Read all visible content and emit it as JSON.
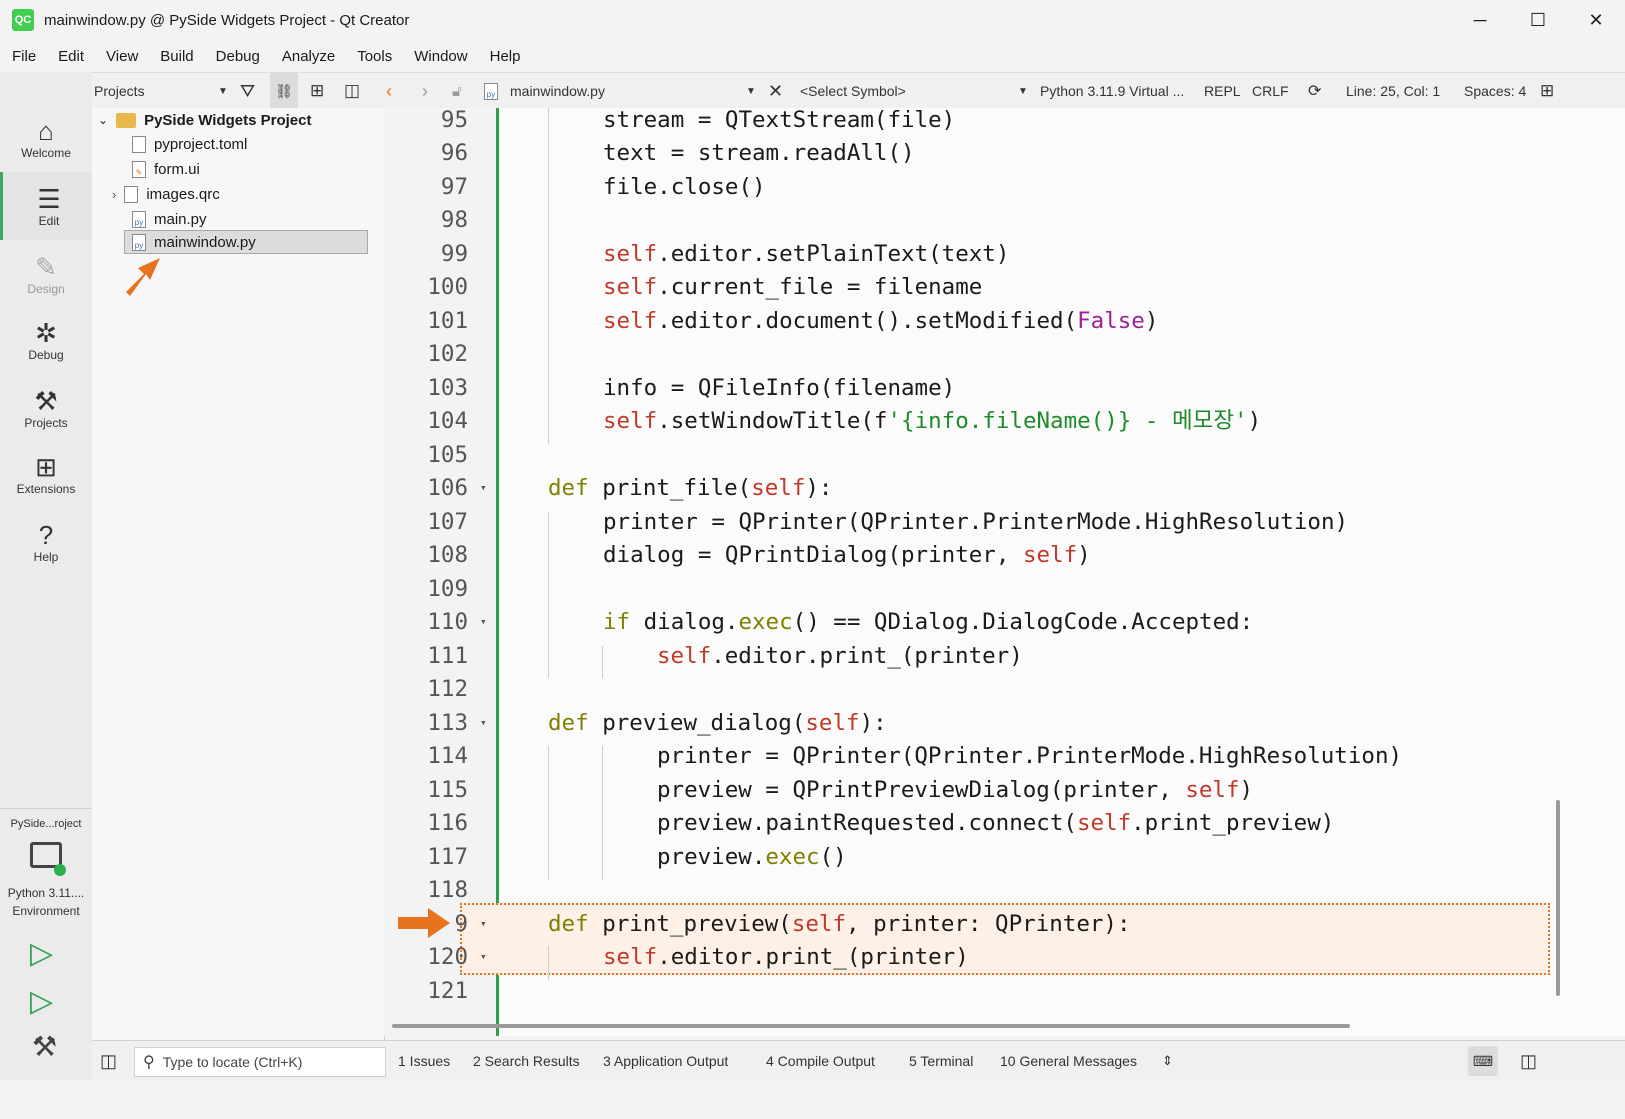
{
  "window": {
    "title": "mainwindow.py @ PySide Widgets Project - Qt Creator",
    "app_icon": "QC",
    "minimize_icon": "─",
    "maximize_icon": "☐",
    "close_icon": "✕"
  },
  "menu": [
    "File",
    "Edit",
    "View",
    "Build",
    "Debug",
    "Analyze",
    "Tools",
    "Window",
    "Help"
  ],
  "toolbar": {
    "projects_combo": "Projects",
    "file_combo": "mainwindow.py",
    "symbol_combo": "<Select Symbol>",
    "python_env": "Python 3.11.9 Virtual ...",
    "repl": "REPL",
    "line_ending": "CRLF",
    "cursor_pos": "Line: 25, Col: 1",
    "spaces": "Spaces: 4"
  },
  "modes": [
    {
      "label": "Welcome",
      "icon": "home-icon"
    },
    {
      "label": "Edit",
      "icon": "edit-icon"
    },
    {
      "label": "Design",
      "icon": "design-icon"
    },
    {
      "label": "Debug",
      "icon": "debug-icon"
    },
    {
      "label": "Projects",
      "icon": "wrench-icon"
    },
    {
      "label": "Extensions",
      "icon": "extensions-icon"
    },
    {
      "label": "Help",
      "icon": "help-icon"
    }
  ],
  "target": {
    "project": "PySide...roject",
    "kit_line1": "Python 3.11....",
    "kit_line2": "Environment"
  },
  "tree": {
    "project": "PySide Widgets Project",
    "files": [
      "pyproject.toml",
      "form.ui",
      "images.qrc",
      "main.py",
      "mainwindow.py"
    ]
  },
  "code": {
    "line_numbers": [
      "95",
      "96",
      "97",
      "98",
      "99",
      "100",
      "101",
      "102",
      "103",
      "104",
      "105",
      "106",
      "107",
      "108",
      "109",
      "110",
      "111",
      "112",
      "113",
      "114",
      "115",
      "116",
      "117",
      "118",
      "9",
      "120",
      "121"
    ],
    "lines": [
      "stream = QTextStream(file)",
      "text = stream.readAll()",
      "file.close()",
      "",
      ".editor.setPlainText(text)",
      ".current_file = filename",
      ".editor.document().setModified(",
      "",
      "info = QFileInfo(filename)",
      ".setWindowTitle(f",
      "",
      "print_file(",
      "printer = QPrinter(QPrinter.PrinterMode.HighResolution)",
      "dialog = QPrintDialog(printer, ",
      "",
      " dialog.",
      ".editor.print_(printer)",
      "",
      "preview_dialog(",
      "printer = QPrinter(QPrinter.PrinterMode.HighResolution)",
      "preview = QPrintPreviewDialog(printer, ",
      "preview.paintRequested.connect(",
      "preview.",
      "",
      "print_preview(",
      ".editor.print_(printer)",
      ""
    ],
    "tokens": {
      "self": "self",
      "def": "def",
      "if": "if",
      "false": "False",
      "exec": "exec",
      "fstring": "'{info.fileName()} - 메모장'",
      "close_paren": ")",
      "self_close": "):",
      "cond_rest": "() == QDialog.DialogCode.Accepted:",
      "print_preview_ref": ".print_preview)",
      "exec_call": "()",
      "print_preview_args": ", printer: QPrinter):"
    }
  },
  "status": {
    "locate_placeholder": "Type to locate (Ctrl+K)",
    "panes": [
      "1  Issues",
      "2  Search Results",
      "3  Application Output",
      "4  Compile Output",
      "5  Terminal",
      "10  General Messages"
    ]
  },
  "colors": {
    "accent_green": "#2e9e4a",
    "annotation_orange": "#e8731f",
    "keyword": "#808000",
    "self": "#c0392b",
    "string": "#1e8a2a"
  }
}
